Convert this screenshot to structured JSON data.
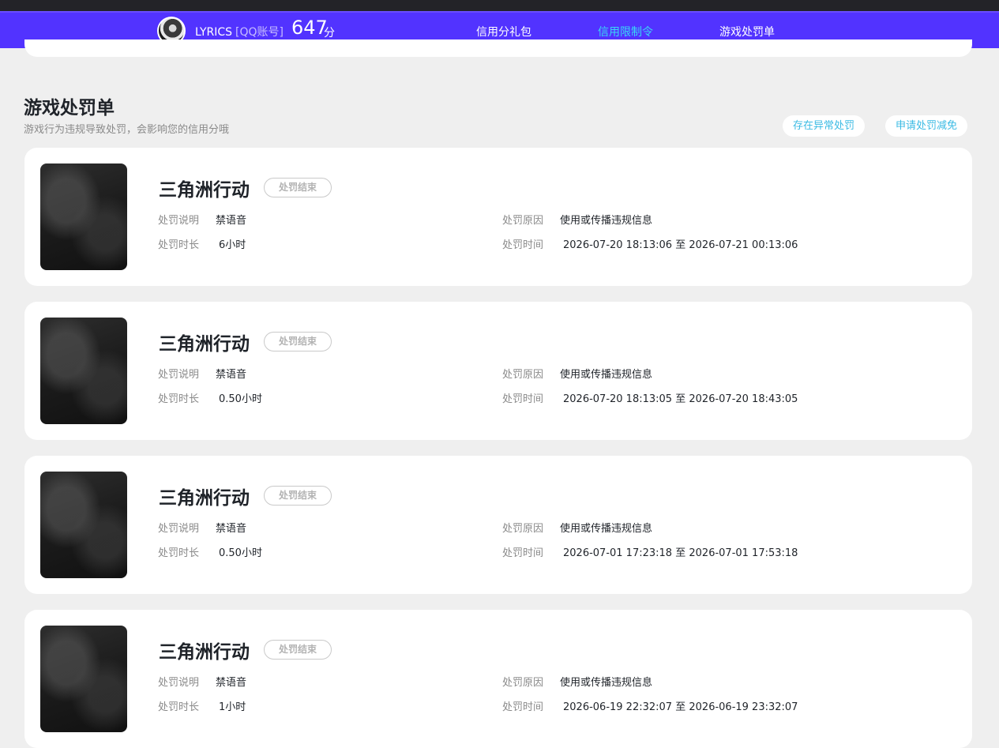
{
  "header": {
    "username": "LYRICS",
    "account_type": "[QQ账号]",
    "score": "647",
    "score_unit": "分",
    "tabs": [
      {
        "label": "信用分礼包",
        "active": false
      },
      {
        "label": "信用限制令",
        "active": true
      },
      {
        "label": "游戏处罚单",
        "active": false
      }
    ],
    "accent_color": "#5233ff",
    "active_color": "#39d7f5"
  },
  "section": {
    "title": "游戏处罚单",
    "subtitle": "游戏行为违规导致处罚，会影响您的信用分哦",
    "buttons": [
      "存在异常处罚",
      "申请处罚减免"
    ]
  },
  "labels": {
    "desc": "处罚说明",
    "reason": "处罚原因",
    "duration": "处罚时长",
    "time": "处罚时间",
    "time_separator": "至"
  },
  "records": [
    {
      "game": "三角洲行动",
      "status": "处罚结束",
      "description": "禁语音",
      "reason": "使用或传播违规信息",
      "duration": "6小时",
      "start": "2026-07-20 18:13:06",
      "end": "2026-07-21 00:13:06"
    },
    {
      "game": "三角洲行动",
      "status": "处罚结束",
      "description": "禁语音",
      "reason": "使用或传播违规信息",
      "duration": "0.50小时",
      "start": "2026-07-20 18:13:05",
      "end": "2026-07-20 18:43:05"
    },
    {
      "game": "三角洲行动",
      "status": "处罚结束",
      "description": "禁语音",
      "reason": "使用或传播违规信息",
      "duration": "0.50小时",
      "start": "2026-07-01 17:23:18",
      "end": "2026-07-01 17:53:18"
    },
    {
      "game": "三角洲行动",
      "status": "处罚结束",
      "description": "禁语音",
      "reason": "使用或传播违规信息",
      "duration": "1小时",
      "start": "2026-06-19 22:32:07",
      "end": "2026-06-19 23:32:07"
    }
  ]
}
